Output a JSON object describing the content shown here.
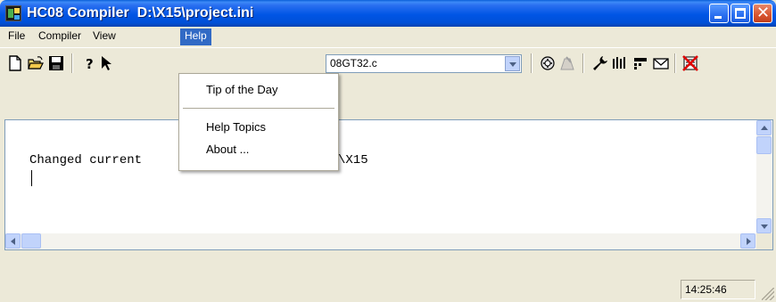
{
  "window": {
    "title": "HC08 Compiler  D:\\X15\\project.ini"
  },
  "menubar": {
    "items": [
      {
        "label": "File"
      },
      {
        "label": "Compiler"
      },
      {
        "label": "View"
      },
      {
        "label": "Help"
      }
    ]
  },
  "help_menu": {
    "items": [
      {
        "label": "Tip of the Day"
      },
      {
        "label": "Help Topics"
      },
      {
        "label": "About ..."
      }
    ]
  },
  "toolbar": {
    "file_combo_value": "08GT32.c",
    "icons": [
      "new-file-icon",
      "open-folder-icon",
      "save-disk-icon",
      "help-question-icon",
      "context-help-arrow-icon",
      "compile-icon",
      "stop-icon",
      "options-wrench-icon",
      "type-sizes-icon",
      "smart-slider-icon",
      "message-icon",
      "clear-log-icon"
    ]
  },
  "output": {
    "line_left": "Changed current",
    "line_right": "\\X15"
  },
  "statusbar": {
    "time": "14:25:46"
  },
  "colors": {
    "titlebar": "#0055e5",
    "menu_highlight": "#316ac5",
    "window_bg": "#ece9d8"
  }
}
